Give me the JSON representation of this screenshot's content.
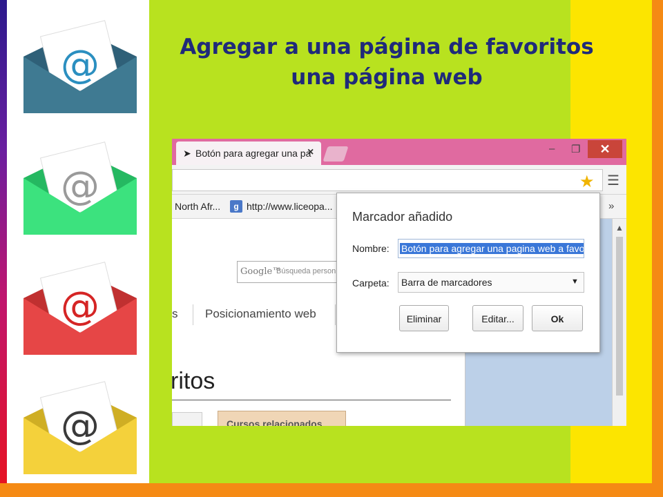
{
  "slide": {
    "title_line1": "Agregar a una página de favoritos",
    "title_line2": "una página web",
    "colors": {
      "slide_bg": "#b8e21f",
      "title": "#1f2a7a",
      "right_band_yellow": "#fce500",
      "right_band_orange": "#f58a14"
    }
  },
  "envelopes": [
    {
      "icon": "envelope-at-icon",
      "color": "#3f7a92"
    },
    {
      "icon": "envelope-at-icon",
      "color": "#3ce27e"
    },
    {
      "icon": "envelope-at-icon",
      "color": "#e64646"
    },
    {
      "icon": "envelope-at-icon",
      "color": "#f4d13b"
    }
  ],
  "browser": {
    "tab_title": "Botón para agregar una pa",
    "tab_close": "×",
    "window_controls": {
      "minimize": "–",
      "restore": "❐",
      "close": "✕"
    },
    "bookmarks": {
      "item1": "North Afr...",
      "item2_icon": "g",
      "item2": "http://www.liceopa...",
      "more": "»"
    },
    "page": {
      "search_logo": "Google™",
      "search_placeholder": "Búsqueda person",
      "nav_partial": "s",
      "nav_item": "Posicionamiento web",
      "heading_partial": "ritos",
      "button_partial": "Cursos relacionados"
    },
    "bookmark_popup": {
      "title": "Marcador añadido",
      "name_label": "Nombre:",
      "name_value": "Botón para agregar una pagina web a favorit",
      "folder_label": "Carpeta:",
      "folder_value": "Barra de marcadores",
      "remove_label": "Eliminar",
      "edit_label": "Editar...",
      "ok_label": "Ok"
    }
  }
}
